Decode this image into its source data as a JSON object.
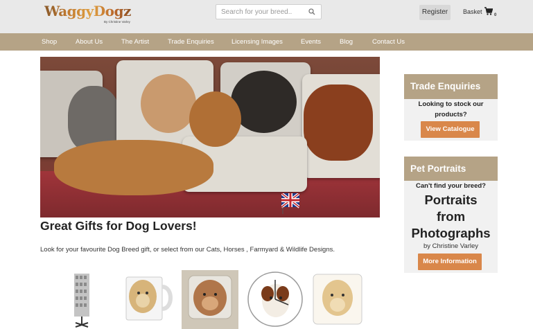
{
  "header": {
    "logo_text": "WaggyDogz",
    "logo_sub": "By Christine Varley",
    "search_placeholder": "Search for your breed..",
    "register_label": "Register",
    "basket_label": "Basket",
    "basket_count": "0"
  },
  "nav": {
    "items": [
      "Shop",
      "About Us",
      "The Artist",
      "Trade Enquiries",
      "Licensing Images",
      "Events",
      "Blog",
      "Contact Us"
    ]
  },
  "main": {
    "heading": "Great Gifts for Dog Lovers!",
    "intro": "Look for your favourite Dog Breed gift, or select from our Cats, Horses , Farmyard & Wildlife Designs."
  },
  "sidebar": {
    "trade": {
      "title": "Trade Enquiries",
      "text_line1": "Looking to stock our",
      "text_line2": "products?",
      "button": "View Catalogue"
    },
    "portraits": {
      "title": "Pet Portraits",
      "question": "Can't find your breed?",
      "big_line1": "Portraits",
      "big_line2": "from",
      "big_line3": "Photographs",
      "by": "by Christine Varley",
      "button": "More Information"
    }
  },
  "colors": {
    "nav_bg": "#b5a386",
    "button_orange": "#d9874a",
    "header_bg": "#e9e9e9"
  },
  "icons": {
    "search": "search-icon",
    "basket": "cart-icon"
  }
}
